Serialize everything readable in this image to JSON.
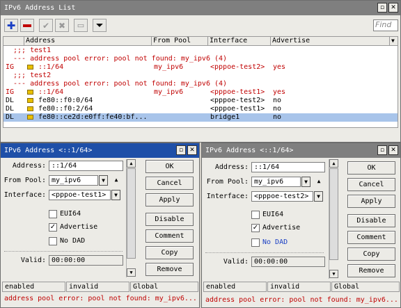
{
  "main": {
    "title": "IPv6 Address List",
    "find_placeholder": "Find",
    "columns": [
      "Address",
      "From Pool",
      "Interface",
      "Advertise"
    ],
    "rows": [
      {
        "flags": "",
        "addr": ";;; test1",
        "pool": "",
        "iface": "",
        "adv": "",
        "style": "comment"
      },
      {
        "flags": "",
        "addr": "--- address pool error: pool not found: my_ipv6 (4)",
        "pool": "",
        "iface": "",
        "adv": "",
        "style": "comment"
      },
      {
        "flags": "IG",
        "addr": "::1/64",
        "pool": "my_ipv6",
        "iface": "<pppoe-test2>",
        "adv": "yes",
        "style": "invalid"
      },
      {
        "flags": "",
        "addr": ";;; test2",
        "pool": "",
        "iface": "",
        "adv": "",
        "style": "comment"
      },
      {
        "flags": "",
        "addr": "--- address pool error: pool not found: my_ipv6 (4)",
        "pool": "",
        "iface": "",
        "adv": "",
        "style": "comment"
      },
      {
        "flags": "IG",
        "addr": "::1/64",
        "pool": "my_ipv6",
        "iface": "<pppoe-test1>",
        "adv": "yes",
        "style": "invalid"
      },
      {
        "flags": "DL",
        "addr": "fe80::f0:0/64",
        "pool": "",
        "iface": "<pppoe-test2>",
        "adv": "no",
        "style": "normal"
      },
      {
        "flags": "DL",
        "addr": "fe80::f0:2/64",
        "pool": "",
        "iface": "<pppoe-test1>",
        "adv": "no",
        "style": "normal"
      },
      {
        "flags": "DL",
        "addr": "fe80::ce2d:e0ff:fe40:bf...",
        "pool": "",
        "iface": "bridge1",
        "adv": "no",
        "style": "selected"
      }
    ]
  },
  "labels": {
    "address": "Address:",
    "from_pool": "From Pool:",
    "interface": "Interface:",
    "eui64": "EUI64",
    "advertise": "Advertise",
    "no_dad": "No DAD",
    "valid": "Valid:"
  },
  "buttons": [
    "OK",
    "Cancel",
    "Apply",
    "Disable",
    "Comment",
    "Copy",
    "Remove"
  ],
  "dialog1": {
    "title": "IPv6 Address <::1/64>",
    "address": "::1/64",
    "from_pool": "my_ipv6",
    "interface": "<pppoe-test1>",
    "valid": "00:00:00",
    "status": [
      "enabled",
      "invalid",
      "Global"
    ],
    "error": "address pool error: pool not found: my_ipv6..."
  },
  "dialog2": {
    "title": "IPv6 Address <::1/64>",
    "address": "::1/64",
    "from_pool": "my_ipv6",
    "interface": "<pppoe-test2>",
    "valid": "00:00:00",
    "status": [
      "enabled",
      "invalid",
      "Global"
    ],
    "error": "address pool error: pool not found: my_ipv6..."
  },
  "colors": {
    "active_title": "#1e4fa8",
    "error_text": "#c00000",
    "selected_row": "#a8c4ea"
  }
}
